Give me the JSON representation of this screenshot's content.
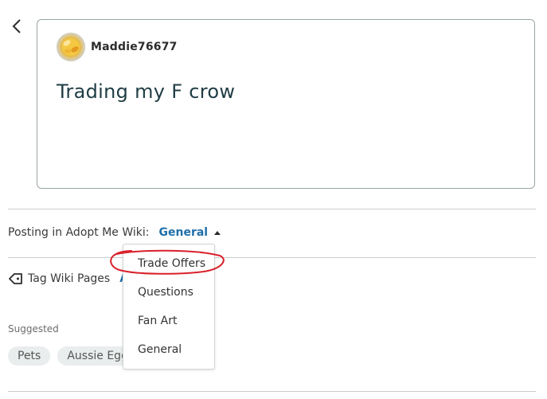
{
  "post": {
    "username": "Maddie76677",
    "title": "Trading my F crow"
  },
  "posting": {
    "label": "Posting in Adopt Me Wiki:",
    "selected_category": "General"
  },
  "tags": {
    "label": "Tag Wiki Pages",
    "add_label": "Ad"
  },
  "suggested": {
    "label": "Suggested",
    "chips": [
      "Pets",
      "Aussie Egg"
    ]
  },
  "dropdown": {
    "options": [
      "Trade Offers",
      "Questions",
      "Fan Art",
      "General"
    ]
  },
  "colors": {
    "accent": "#1f6fa8",
    "annotation": "#d9202a"
  },
  "icons": {
    "back": "back-arrow-icon",
    "tag": "tag-icon",
    "caret": "caret-up-icon"
  }
}
